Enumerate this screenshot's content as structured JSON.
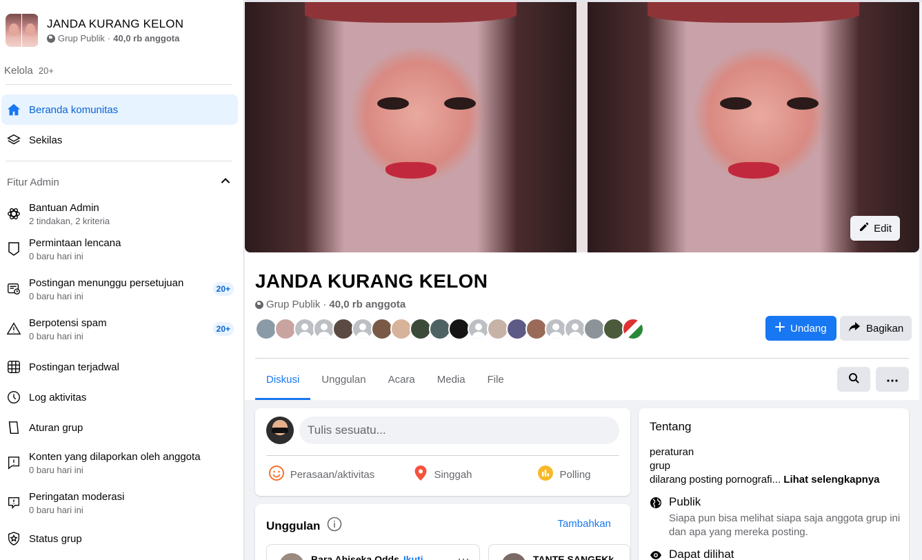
{
  "group": {
    "name": "JANDA KURANG KELON",
    "privacy": "Grup Publik",
    "members": "40,0 rb anggota"
  },
  "sidebar": {
    "manage_label": "Kelola",
    "manage_count": "20+",
    "nav": [
      {
        "label": "Beranda komunitas",
        "icon": "home-icon",
        "active": true
      },
      {
        "label": "Sekilas",
        "icon": "layers-icon",
        "active": false
      }
    ],
    "admin_section": "Fitur Admin",
    "admin_items": [
      {
        "label": "Bantuan Admin",
        "sub": "2 tindakan, 2 kriteria",
        "icon": "atom-icon",
        "badge": ""
      },
      {
        "label": "Permintaan lencana",
        "sub": "0 baru hari ini",
        "icon": "badge-shield-icon",
        "badge": ""
      },
      {
        "label": "Postingan menunggu persetujuan",
        "sub": "0 baru hari ini",
        "icon": "pending-post-icon",
        "badge": "20+"
      },
      {
        "label": "Berpotensi spam",
        "sub": "0 baru hari ini",
        "icon": "warning-icon",
        "badge": "20+"
      },
      {
        "label": "Postingan terjadwal",
        "sub": "",
        "icon": "calendar-grid-icon",
        "badge": ""
      },
      {
        "label": "Log aktivitas",
        "sub": "",
        "icon": "clock-icon",
        "badge": ""
      },
      {
        "label": "Aturan grup",
        "sub": "",
        "icon": "rules-icon",
        "badge": ""
      },
      {
        "label": "Konten yang dilaporkan oleh anggota",
        "sub": "0 baru hari ini",
        "icon": "report-icon",
        "badge": ""
      },
      {
        "label": "Peringatan moderasi",
        "sub": "0 baru hari ini",
        "icon": "moderation-alert-icon",
        "badge": ""
      },
      {
        "label": "Status grup",
        "sub": "",
        "icon": "status-shield-icon",
        "badge": ""
      }
    ]
  },
  "header": {
    "edit_label": "Edit",
    "invite_label": "Undang",
    "share_label": "Bagikan",
    "tabs": [
      "Diskusi",
      "Unggulan",
      "Acara",
      "Media",
      "File"
    ],
    "active_tab": "Diskusi"
  },
  "composer": {
    "placeholder": "Tulis sesuatu...",
    "actions": [
      {
        "label": "Perasaan/aktivitas",
        "icon": "smiley-icon",
        "color": "#f7b928"
      },
      {
        "label": "Singgah",
        "icon": "location-pin-icon",
        "color": "#f5533d"
      },
      {
        "label": "Polling",
        "icon": "poll-icon",
        "color": "#f7b928"
      }
    ]
  },
  "featured": {
    "title": "Unggulan",
    "add_label": "Tambahkan",
    "cards": [
      {
        "name": "Bara Abiseka Odds",
        "follow": "Ikuti"
      },
      {
        "name": "TANTE SANGEKk",
        "follow": ""
      }
    ]
  },
  "about": {
    "title": "Tentang",
    "desc_lines": [
      "peraturan",
      "grup",
      "dilarang posting pornografi..."
    ],
    "see_more": "Lihat selengkapnya",
    "public_title": "Publik",
    "public_desc": "Siapa pun bisa melihat siapa saja anggota grup ini dan apa yang mereka posting.",
    "visible_title": "Dapat dilihat"
  },
  "colors": {
    "primary": "#1877f2",
    "active_bg": "#e7f3ff",
    "muted_text": "#65676b"
  }
}
